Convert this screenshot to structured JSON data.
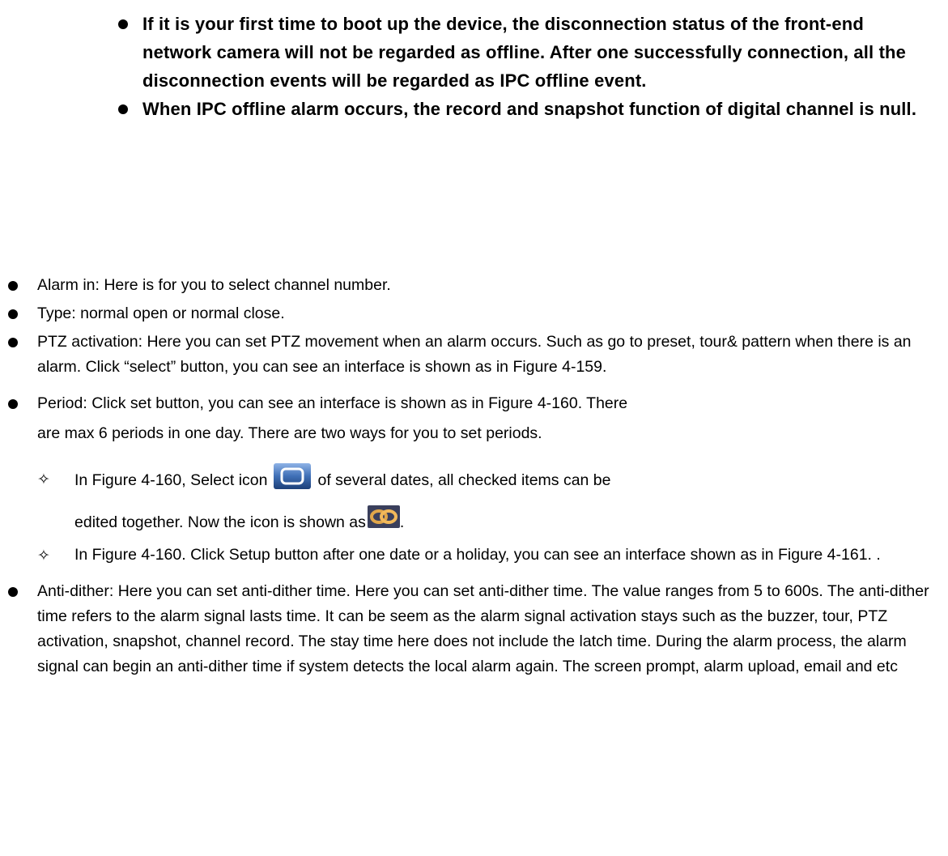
{
  "note": {
    "items": [
      "If it is your first time to boot up the device, the disconnection status of the front-end network camera will not be regarded as offline. After one successfully connection, all the disconnection events will be regarded as IPC offline event.",
      "When IPC offline alarm occurs, the record and snapshot function of digital channel is null."
    ]
  },
  "bullets": {
    "alarm_in": "Alarm in: Here is for you to select channel number.",
    "type": "Type: normal open or normal close.",
    "ptz": "PTZ activation: Here you can set PTZ movement when an alarm occurs. Such as go to preset, tour& pattern when there is an alarm. Click “select” button, you can see an interface is shown as in Figure 4-159.",
    "period_line1": "Period: Click set button, you can see an interface is shown as in Figure 4-160. There",
    "period_line2": "are max 6 periods in one day. There are two ways for you to set periods.",
    "sub1_before_icon": "In Figure 4-160, Select icon",
    "sub1_after_icon": "of several dates, all checked items can be",
    "sub1_line2": "edited together. Now the icon is shown as",
    "sub1_line2_end": ".",
    "sub2": "In Figure 4-160. Click Setup button after one date or a holiday, you can see an interface shown as in Figure 4-161. .",
    "antidither": "Anti-dither: Here you can set anti-dither time. Here you can set anti-dither time. The value ranges from 5 to 600s. The anti-dither time refers to the alarm signal lasts time. It can be seem as the alarm signal activation stays such as the buzzer, tour, PTZ activation, snapshot, channel record. The stay time here does not include the latch time. During the alarm process, the alarm signal can begin an anti-dither time if system detects the local alarm again. The screen prompt, alarm upload, email and etc"
  },
  "icons": {
    "select": "select-square-icon",
    "link": "chain-link-icon",
    "diamond": "✧",
    "bullet": "●"
  }
}
